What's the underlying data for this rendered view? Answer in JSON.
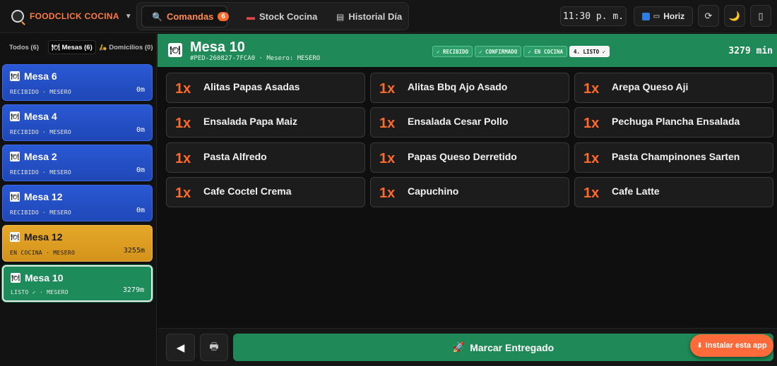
{
  "app": {
    "name": "FOODCLICK COCINA"
  },
  "nav": {
    "tabs": [
      {
        "label": "Comandas",
        "badge": "6",
        "icon": "search-icon"
      },
      {
        "label": "Stock Cocina",
        "icon": "meat-icon"
      },
      {
        "label": "Historial Día",
        "icon": "clipboard-icon"
      }
    ]
  },
  "header": {
    "clock": "11:30 p. m.",
    "layout_label": "Horiz",
    "refresh_glyph": "⟳",
    "theme_glyph": "🌙",
    "device_glyph": "▯"
  },
  "filters": [
    {
      "label": "Todos (6)"
    },
    {
      "label": "Mesas (6)",
      "icon": "🍽"
    },
    {
      "label": "Domicilios (0)",
      "icon": "🛵"
    }
  ],
  "orders": [
    {
      "title": "Mesa 6",
      "status": "RECIBIDO · MESERO",
      "time": "0m",
      "color": "#2a59d4"
    },
    {
      "title": "Mesa 4",
      "status": "RECIBIDO · MESERO",
      "time": "0m",
      "color": "#2a59d4"
    },
    {
      "title": "Mesa 2",
      "status": "RECIBIDO · MESERO",
      "time": "0m",
      "color": "#2a59d4"
    },
    {
      "title": "Mesa 12",
      "status": "RECIBIDO · MESERO",
      "time": "0m",
      "color": "#2a59d4"
    },
    {
      "title": "Mesa 12",
      "status": "EN COCINA · MESERO",
      "time": "3255m",
      "color": "#e6a82b"
    },
    {
      "title": "Mesa 10",
      "status": "LISTO ✓ · MESERO",
      "time": "3279m",
      "color": "#1e8b5a"
    }
  ],
  "detail": {
    "title": "Mesa 10",
    "meta": "#PED-260827-7FCA0 · Mesero: MESERO",
    "steps": [
      "✓ RECIBIDO",
      "✓ CONFIRMADO",
      "✓ EN COCINA",
      "4. LISTO ✓"
    ],
    "elapsed": "3279 min",
    "items": [
      {
        "qty": "1x",
        "name": "Alitas Papas Asadas"
      },
      {
        "qty": "1x",
        "name": "Alitas Bbq Ajo Asado"
      },
      {
        "qty": "1x",
        "name": "Arepa Queso Aji"
      },
      {
        "qty": "1x",
        "name": "Ensalada Papa Maiz"
      },
      {
        "qty": "1x",
        "name": "Ensalada Cesar Pollo"
      },
      {
        "qty": "1x",
        "name": "Pechuga Plancha Ensalada"
      },
      {
        "qty": "1x",
        "name": "Pasta Alfredo"
      },
      {
        "qty": "1x",
        "name": "Papas Queso Derretido"
      },
      {
        "qty": "1x",
        "name": "Pasta Champinones Sarten"
      },
      {
        "qty": "1x",
        "name": "Cafe Coctel Crema"
      },
      {
        "qty": "1x",
        "name": "Capuchino"
      },
      {
        "qty": "1x",
        "name": "Cafe Latte"
      }
    ]
  },
  "actions": {
    "back_glyph": "◀",
    "print_glyph": "🖶",
    "deliver_label": "Marcar Entregado",
    "install_label": "Instalar esta app"
  }
}
